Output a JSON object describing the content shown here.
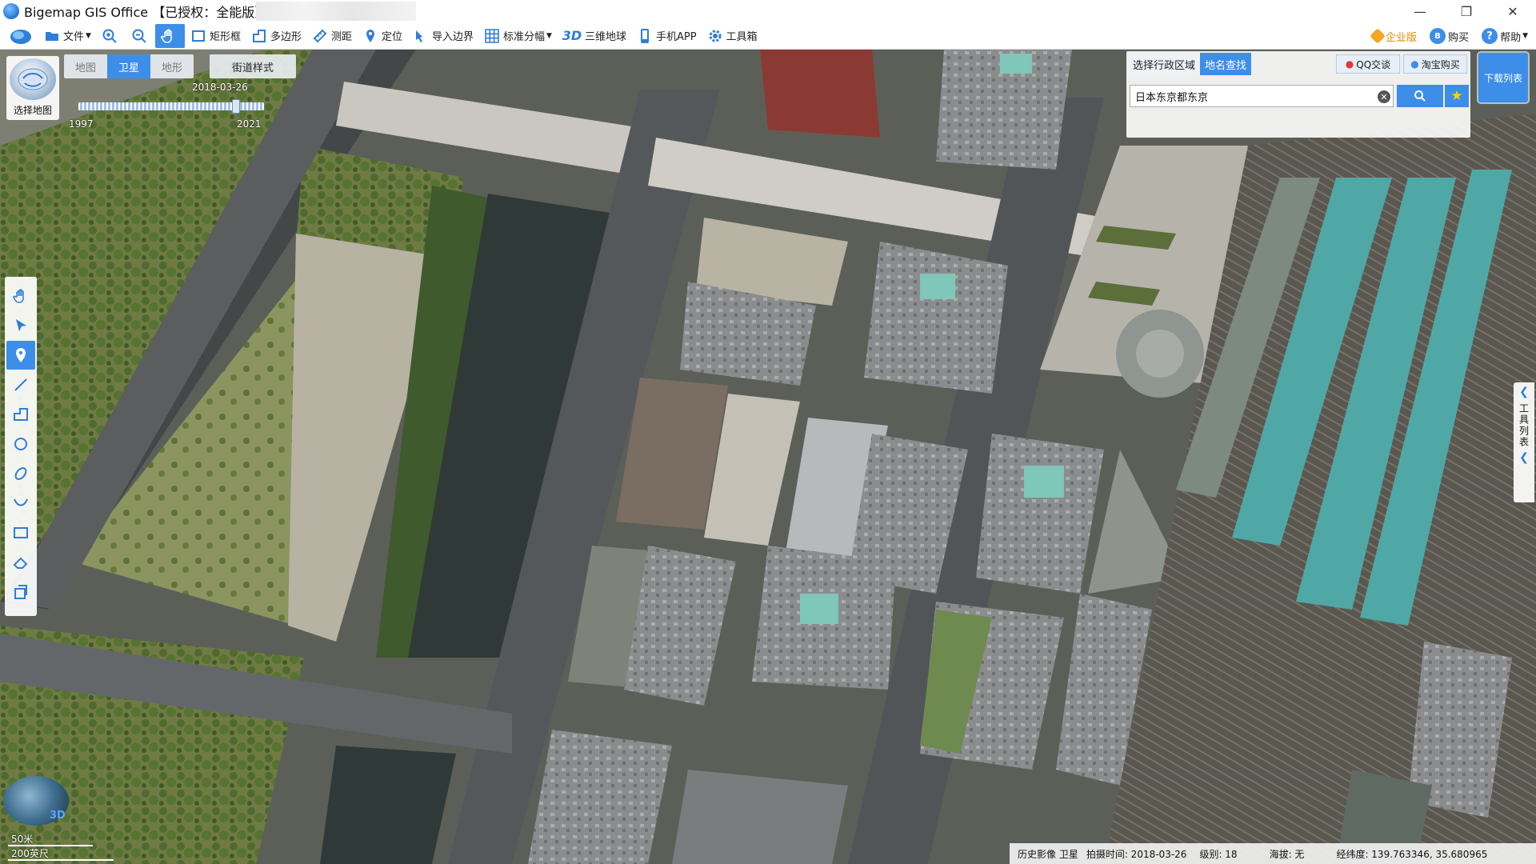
{
  "window": {
    "title": "Bigemap GIS Office 【已授权：全能版】",
    "controls": {
      "minimize": "—",
      "maximize": "❐",
      "close": "✕"
    }
  },
  "toolbar": {
    "items": [
      {
        "key": "file",
        "label": "文件",
        "icon": "folder-icon",
        "dropdown": true
      },
      {
        "key": "zoom_in",
        "label": "",
        "icon": "zoom-in-icon"
      },
      {
        "key": "zoom_out",
        "label": "",
        "icon": "zoom-out-icon"
      },
      {
        "key": "pan",
        "label": "",
        "icon": "hand-icon",
        "active": true
      },
      {
        "key": "rectangle",
        "label": "矩形框",
        "icon": "rectangle-select-icon"
      },
      {
        "key": "polygon",
        "label": "多边形",
        "icon": "polygon-select-icon"
      },
      {
        "key": "measure",
        "label": "测距",
        "icon": "ruler-icon"
      },
      {
        "key": "locate",
        "label": "定位",
        "icon": "location-pin-icon"
      },
      {
        "key": "import_boundary",
        "label": "导入边界",
        "icon": "import-boundary-icon"
      },
      {
        "key": "standard_grid",
        "label": "标准分幅",
        "icon": "grid-icon",
        "dropdown": true
      },
      {
        "key": "globe3d",
        "label": "三维地球",
        "icon": "3d-icon"
      },
      {
        "key": "mobile_app",
        "label": "手机APP",
        "icon": "phone-icon"
      },
      {
        "key": "toolbox",
        "label": "工具箱",
        "icon": "gear-icon"
      }
    ],
    "right": {
      "enterprise": "企业版",
      "buy": "购买",
      "help": "帮助"
    }
  },
  "map_controls": {
    "chooser_label": "选择地图",
    "map_types": [
      "地图",
      "卫星",
      "地形"
    ],
    "active_map_type": "卫星",
    "street_style": "街道样式",
    "timeline": {
      "current_date": "2018-03-26",
      "start_year": "1997",
      "end_year": "2021",
      "position_fraction": 0.85
    }
  },
  "left_tools": [
    {
      "name": "pan-tool-icon",
      "active": false
    },
    {
      "name": "select-arrow-icon",
      "active": false
    },
    {
      "name": "marker-pin-icon",
      "active": true
    },
    {
      "name": "line-tool-icon",
      "active": false
    },
    {
      "name": "polygon-tool-icon",
      "active": false
    },
    {
      "name": "circle-tool-icon",
      "active": false
    },
    {
      "name": "ellipse-tool-icon",
      "active": false
    },
    {
      "name": "curve-tool-icon",
      "active": false
    },
    {
      "name": "rectangle-tool-icon",
      "active": false
    },
    {
      "name": "eraser-tool-icon",
      "active": false
    },
    {
      "name": "clipboard-tool-icon",
      "active": false
    }
  ],
  "search_panel": {
    "tabs": [
      "选择行政区域",
      "地名查找"
    ],
    "active_tab": "地名查找",
    "qq_label": "QQ交谈",
    "taobao_label": "淘宝购买",
    "query": "日本东京都东京",
    "download_list": "下载列表"
  },
  "right_toollist": {
    "label": "工具列表"
  },
  "globe_badge": "3D",
  "scale": {
    "top": "50米",
    "bottom": "200英尺"
  },
  "statusbar": {
    "layer": "历史影像 卫星",
    "capture_time": "拍摄时间: 2018-03-26",
    "level": "级别:  18",
    "elevation": "海拔: 无",
    "coords": "经纬度:    139.763346, 35.680965"
  },
  "colors": {
    "accent": "#3d8ee8",
    "icon_blue": "#2f7ed8",
    "enterprise_orange": "#e08a00"
  }
}
